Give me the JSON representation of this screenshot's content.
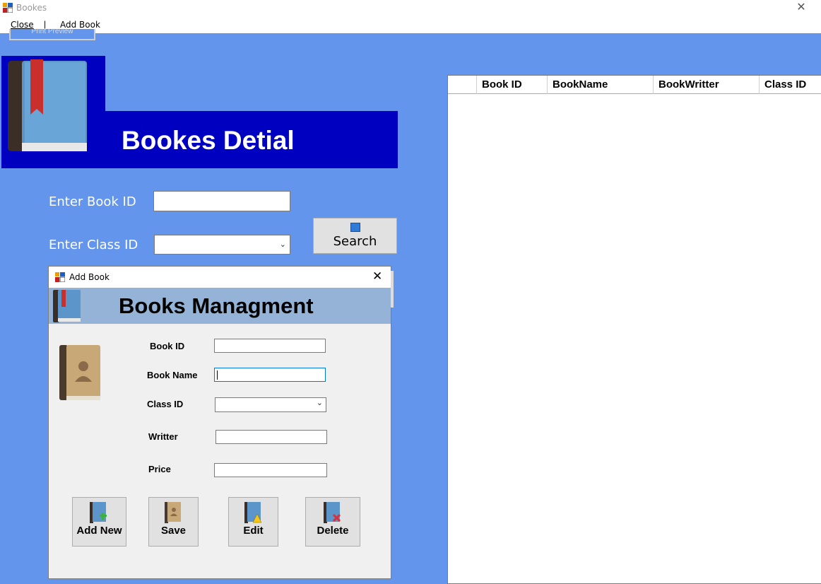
{
  "window": {
    "title": "Bookes"
  },
  "menu": {
    "items": [
      "Close",
      "Add Book"
    ],
    "separator": "|",
    "hidden_button": "Print Preview"
  },
  "banner": {
    "title": "Bookes Detial"
  },
  "search_form": {
    "book_id_label": "Enter Book ID",
    "book_id_value": "",
    "class_id_label": "Enter Class ID",
    "class_id_value": "",
    "search_button": "Search"
  },
  "grid": {
    "columns": [
      "",
      "Book ID",
      "BookName",
      "BookWritter",
      "Class ID"
    ],
    "rows": []
  },
  "dialog": {
    "title": "Add Book",
    "heading": "Books Managment",
    "fields": {
      "book_id": {
        "label": "Book ID",
        "value": ""
      },
      "book_name": {
        "label": "Book Name",
        "value": ""
      },
      "class_id": {
        "label": "Class ID",
        "value": ""
      },
      "writer": {
        "label": "Writter",
        "value": ""
      },
      "price": {
        "label": "Price",
        "value": ""
      }
    },
    "buttons": {
      "add_new": "Add New",
      "save": "Save",
      "edit": "Edit",
      "delete": "Delete"
    }
  },
  "colors": {
    "background": "#6495ED",
    "banner": "#0000C0",
    "dialog_banner": "#94B3D6"
  },
  "icons": [
    "app-icon",
    "book-icon",
    "search-icon",
    "add-book-icon",
    "save-book-icon",
    "edit-book-icon",
    "delete-book-icon"
  ]
}
